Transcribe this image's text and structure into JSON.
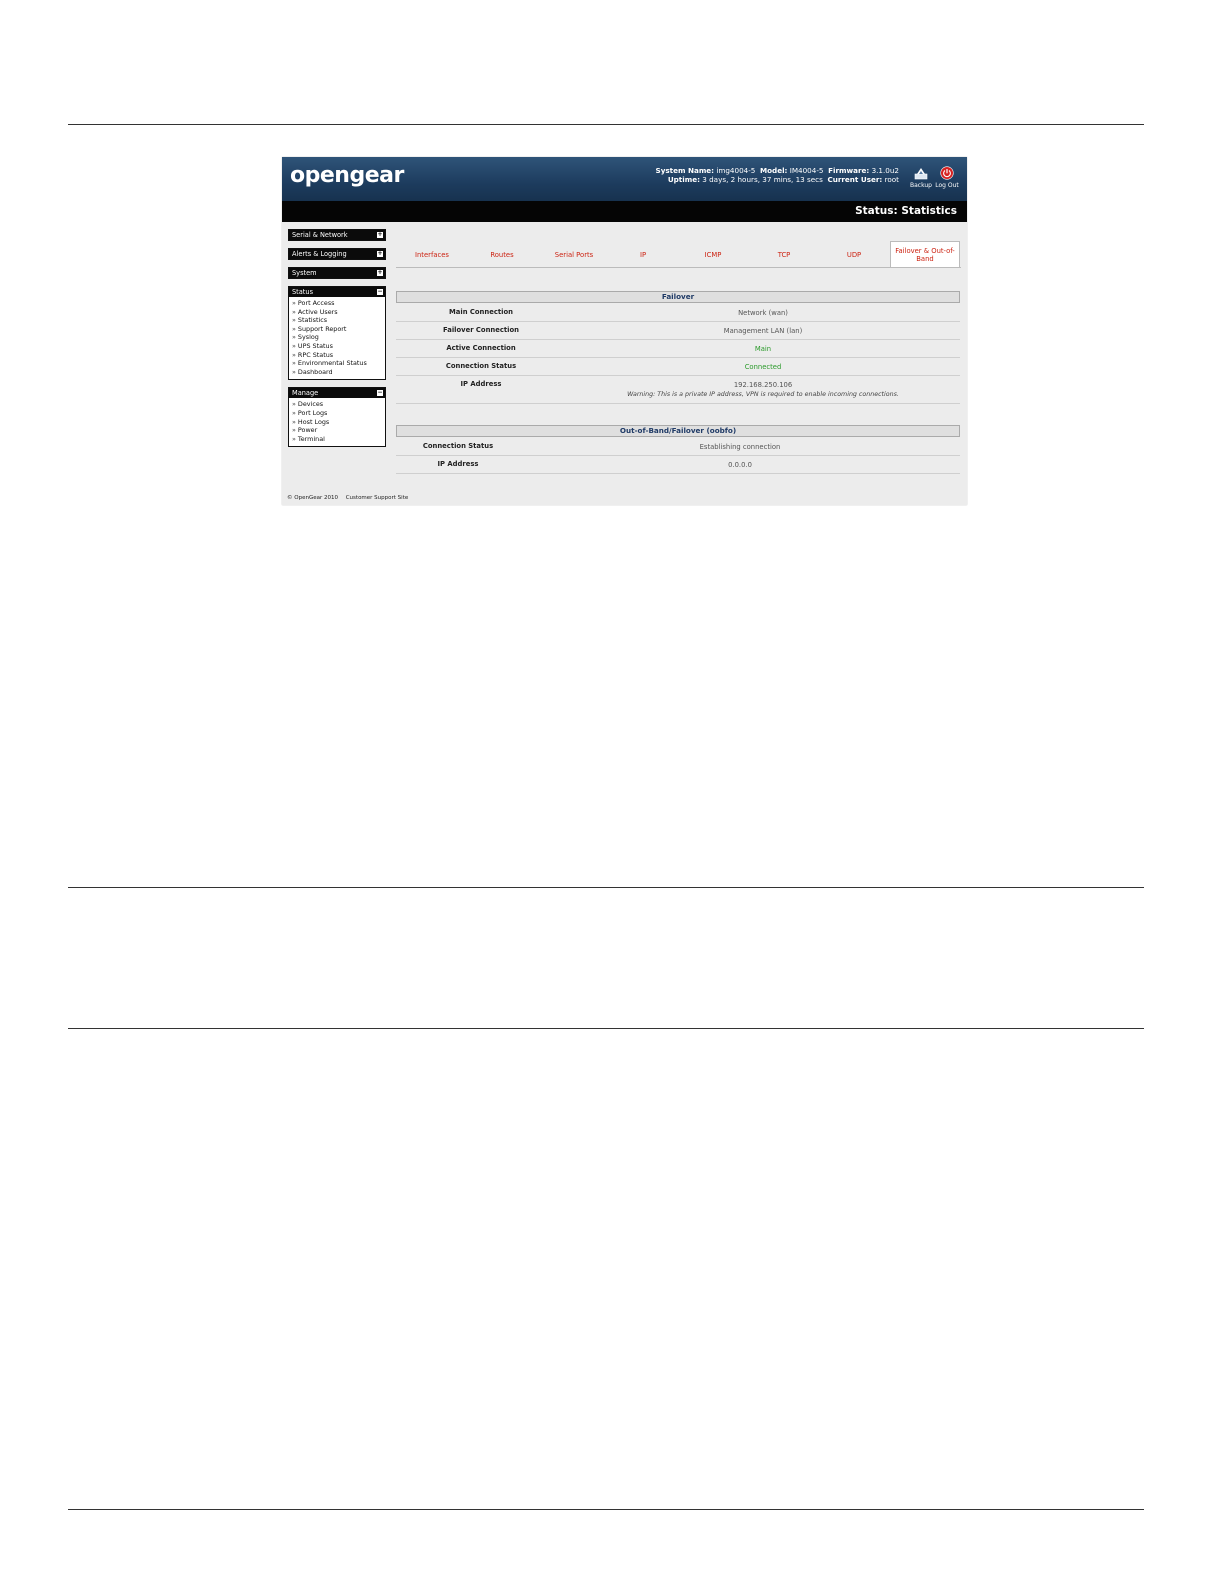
{
  "header": {
    "logo_text": "opengear",
    "system_name_label": "System Name:",
    "system_name_value": "img4004-5",
    "model_label": "Model:",
    "model_value": "IM4004-5",
    "firmware_label": "Firmware:",
    "firmware_value": "3.1.0u2",
    "uptime_label": "Uptime:",
    "uptime_value": "3 days, 2 hours, 37 mins, 13 secs",
    "current_user_label": "Current User:",
    "current_user_value": "root",
    "backup_label": "Backup",
    "logout_label": "Log Out"
  },
  "page_title": "Status: Statistics",
  "sidebar": {
    "sections": [
      {
        "label": "Serial & Network",
        "toggle": "+"
      },
      {
        "label": "Alerts & Logging",
        "toggle": "+"
      },
      {
        "label": "System",
        "toggle": "+"
      }
    ],
    "status": {
      "label": "Status",
      "toggle": "−",
      "items": [
        "Port Access",
        "Active Users",
        "Statistics",
        "Support Report",
        "Syslog",
        "UPS Status",
        "RPC Status",
        "Environmental Status",
        "Dashboard"
      ]
    },
    "manage": {
      "label": "Manage",
      "toggle": "−",
      "items": [
        "Devices",
        "Port Logs",
        "Host Logs",
        "Power",
        "Terminal"
      ]
    },
    "arrow": "»"
  },
  "tabs": [
    "Interfaces",
    "Routes",
    "Serial Ports",
    "IP",
    "ICMP",
    "TCP",
    "UDP",
    "Failover & Out-of-Band"
  ],
  "failover": {
    "title": "Failover",
    "rows": [
      {
        "label": "Main Connection",
        "value": "Network (wan)"
      },
      {
        "label": "Failover Connection",
        "value": "Management LAN (lan)"
      },
      {
        "label": "Active Connection",
        "value": "Main"
      },
      {
        "label": "Connection Status",
        "value": "Connected"
      },
      {
        "label": "IP Address",
        "value": "192.168.250.106",
        "warning": "Warning: This is a private IP address, VPN is required to enable incoming connections."
      }
    ]
  },
  "oobfo": {
    "title": "Out-of-Band/Failover (oobfo)",
    "rows": [
      {
        "label": "Connection Status",
        "value": "Establishing connection"
      },
      {
        "label": "IP Address",
        "value": "0.0.0.0"
      }
    ]
  },
  "footer": {
    "copyright": "© OpenGear 2010",
    "support_link": "Customer Support Site"
  },
  "colors": {
    "banner": "#1d3c5e",
    "tab_text": "#cc2211",
    "section_title": "#1f3a66",
    "status_green": "#2a9a2a"
  }
}
